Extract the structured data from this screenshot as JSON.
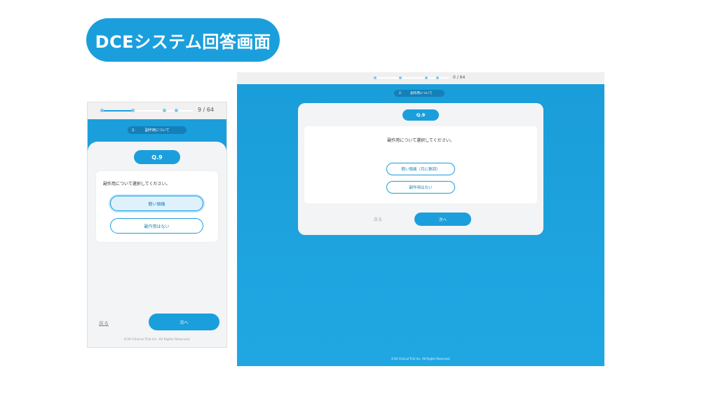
{
  "header": {
    "title": "DCEシステム回答画面"
  },
  "mobile": {
    "progress": {
      "count": "9 / 64",
      "fraction": 0.34
    },
    "section": {
      "number": "2.",
      "label": "副作用について"
    },
    "question_number": "Q.9",
    "question_text": "副作用について選択してください。",
    "options": [
      {
        "label": "軽い頭痛",
        "selected": true
      },
      {
        "label": "副作用はない",
        "selected": false
      }
    ],
    "back_label": "戻る",
    "next_label": "次へ",
    "copyright": "©3H Clinical Trial Inc. All Rights Reserved."
  },
  "desktop": {
    "progress": {
      "count": "0 / 64"
    },
    "section": {
      "number": "2.",
      "label": "副作用について"
    },
    "question_number": "Q.9",
    "question_text": "副作用について選択してください。",
    "options": [
      {
        "label": "軽い頭痛（月に数回）",
        "selected": false
      },
      {
        "label": "副作用はない",
        "selected": false
      }
    ],
    "back_label": "戻る",
    "next_label": "次へ",
    "copyright": "©3H Clinical Trial Inc. All Rights Reserved."
  },
  "colors": {
    "accent": "#1b9fdc",
    "accent_dark": "#1580b8",
    "card": "#f3f4f5"
  }
}
